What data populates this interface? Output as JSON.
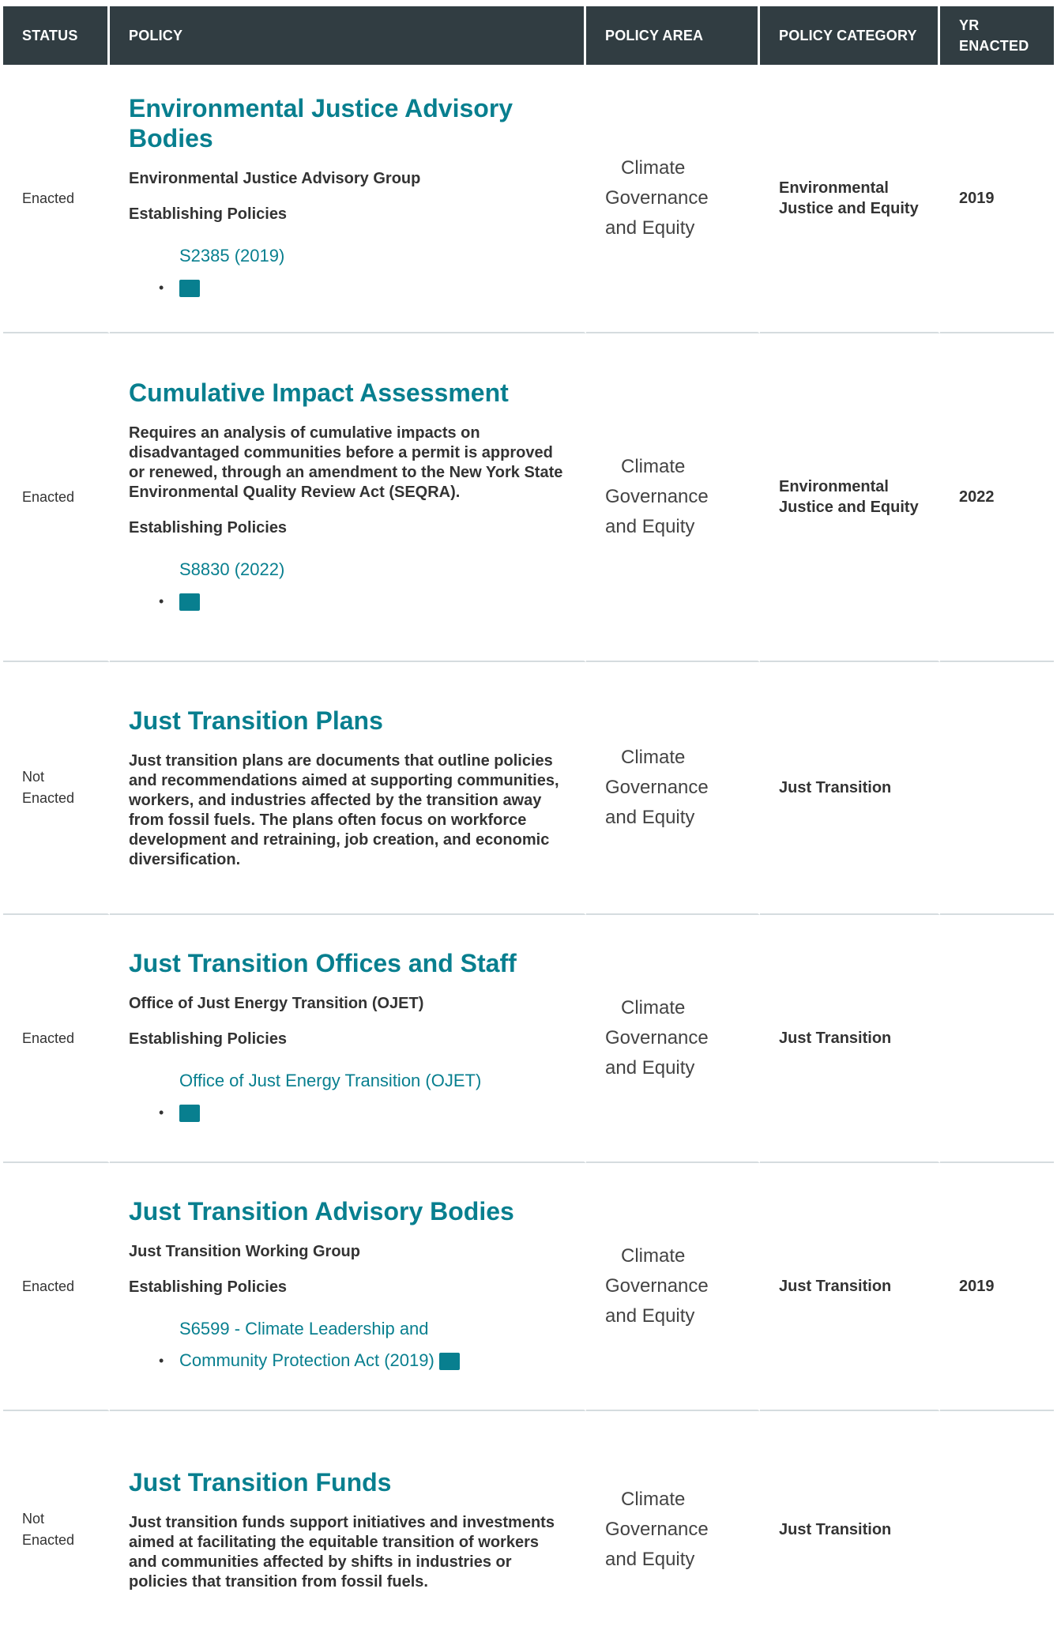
{
  "headers": {
    "status": "STATUS",
    "policy": "POLICY",
    "area": "POLICY AREA",
    "category": "POLICY CATEGORY",
    "year": "YR ENACTED"
  },
  "rows": [
    {
      "status": "Enacted",
      "title": "Environmental Justice Advisory Bodies",
      "desc": "Environmental Justice Advisory Group",
      "est": "Establishing Policies",
      "links": [
        {
          "label": "S2385 (2019)"
        }
      ],
      "area": [
        "Climate",
        "Governance",
        "and Equity"
      ],
      "category": "Environmental Justice and Equity",
      "year": "2019"
    },
    {
      "status": "Enacted",
      "title": "Cumulative Impact Assessment",
      "desc": "Requires an analysis of cumulative impacts on disadvantaged communities before a permit is approved or renewed, through an amendment to the New York State Environmental Quality Review Act (SEQRA).",
      "est": "Establishing Policies",
      "links": [
        {
          "label": "S8830 (2022)"
        }
      ],
      "area": [
        "Climate",
        "Governance",
        "and Equity"
      ],
      "category": "Environmental Justice and Equity",
      "year": "2022"
    },
    {
      "status": "Not Enacted",
      "title": "Just Transition Plans",
      "desc": "Just transition plans are documents that outline policies and recommendations aimed at supporting communities, workers, and industries affected by the transition away from fossil fuels. The plans often focus on workforce development and retraining, job creation, and economic diversification.",
      "area": [
        "Climate",
        "Governance",
        "and Equity"
      ],
      "category": "Just Transition",
      "year": ""
    },
    {
      "status": "Enacted",
      "title": "Just Transition Offices and Staff",
      "desc": "Office of Just Energy Transition (OJET)",
      "est": "Establishing Policies",
      "links": [
        {
          "label": "Office of Just Energy Transition (OJET)"
        }
      ],
      "area": [
        "Climate",
        "Governance",
        "and Equity"
      ],
      "category": "Just Transition",
      "year": ""
    },
    {
      "status": "Enacted",
      "title": "Just Transition Advisory Bodies",
      "desc": "Just Transition Working Group",
      "est": "Establishing Policies",
      "links": [
        {
          "label": "S6599 - Climate Leadership and Community Protection Act (2019)"
        }
      ],
      "area": [
        "Climate",
        "Governance",
        "and Equity"
      ],
      "category": "Just Transition",
      "year": "2019"
    },
    {
      "status": "Not Enacted",
      "title": "Just Transition Funds",
      "desc": "Just transition funds support initiatives and investments aimed at facilitating the equitable transition of workers and communities affected by shifts in industries or policies that transition from fossil fuels.",
      "area": [
        "Climate",
        "Governance",
        "and Equity"
      ],
      "category": "Just Transition",
      "year": ""
    }
  ],
  "colors": {
    "header_bg": "#313d42",
    "link": "#087f8f",
    "divider": "#d5dcdf"
  },
  "icons": {
    "link_icon": "document-icon"
  }
}
